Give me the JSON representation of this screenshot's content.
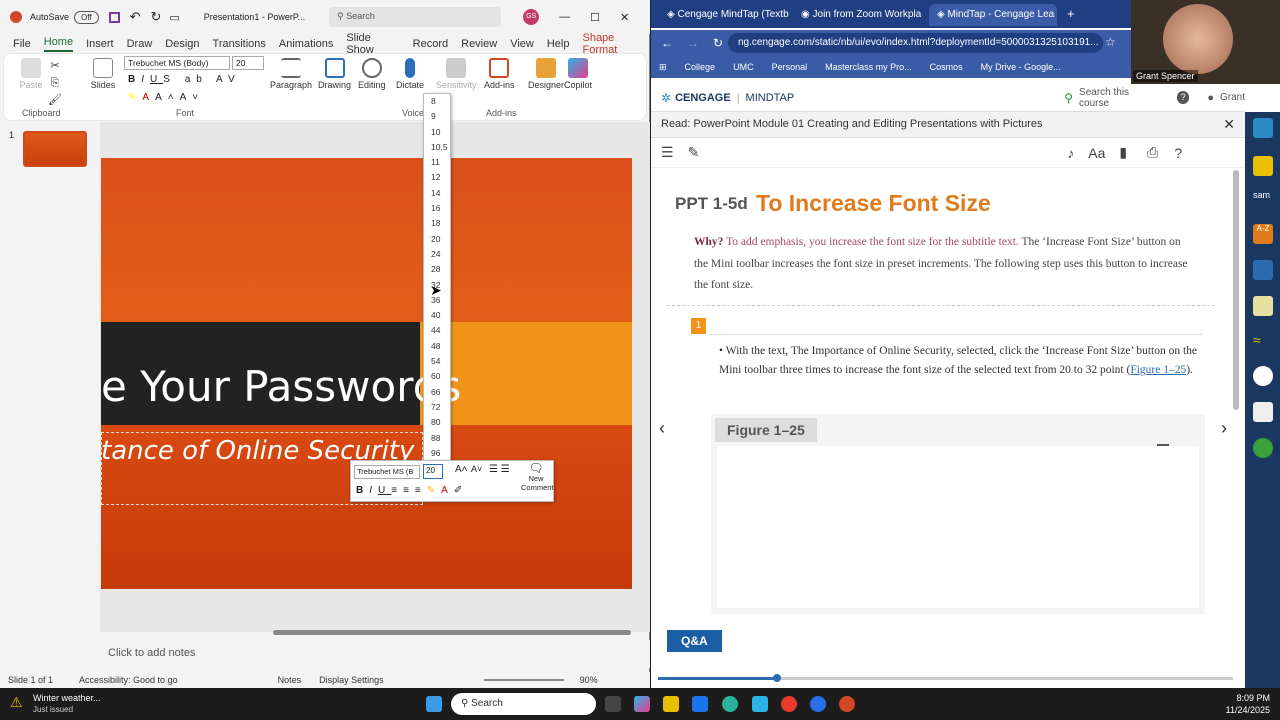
{
  "powerpoint": {
    "autosave_label": "AutoSave",
    "autosave_state": "Off",
    "doc_title": "Presentation1 - PowerP...",
    "search_placeholder": "Search",
    "user_initials": "GS",
    "tabs": [
      "File",
      "Home",
      "Insert",
      "Draw",
      "Design",
      "Transitions",
      "Animations",
      "Slide Show",
      "Record",
      "Review",
      "View",
      "Help",
      "Shape Format"
    ],
    "active_tab": "Home",
    "ribbon": {
      "paste": "Paste",
      "clipboard": "Clipboard",
      "slides": "Slides",
      "font_name": "Trebuchet MS (Body)",
      "font_size": "20",
      "font_group": "Font",
      "paragraph": "Paragraph",
      "drawing": "Drawing",
      "editing": "Editing",
      "dictate": "Dictate",
      "voice": "Voice",
      "sensitivity": "Sensitivity",
      "addins_btn": "Add-ins",
      "addins_grp": "Add-ins",
      "designer": "Designer",
      "copilot": "Copilot"
    },
    "slide_number": "1",
    "slide_title": "e Your Passwords",
    "slide_subtitle": "tance of Online Security",
    "notes_placeholder": "Click to add notes",
    "font_size_options": [
      "8",
      "9",
      "10",
      "10.5",
      "11",
      "12",
      "14",
      "16",
      "18",
      "20",
      "24",
      "28",
      "32",
      "36",
      "40",
      "44",
      "48",
      "54",
      "60",
      "66",
      "72",
      "80",
      "88",
      "96"
    ],
    "mini_toolbar": {
      "font": "Trebuchet MS (B",
      "size": "20",
      "new_comment": "New Comment"
    },
    "status": {
      "slide": "Slide 1 of 1",
      "accessibility": "Accessibility: Good to go",
      "notes": "Notes",
      "display": "Display Settings",
      "zoom": "90%"
    }
  },
  "chrome": {
    "tabs": [
      {
        "label": "Cengage MindTap (Textb"
      },
      {
        "label": "Join from Zoom Workpla"
      },
      {
        "label": "MindTap - Cengage Lea"
      }
    ],
    "url": "ng.cengage.com/static/nb/ui/evo/index.html?deploymentId=5000031325103191...",
    "bookmarks": [
      "College",
      "UMC",
      "Personal",
      "Masterclass my Pro...",
      "Cosmos",
      "My Drive - Google..."
    ],
    "webcam_name": "Grant Spencer"
  },
  "mindtap": {
    "brand": "CENGAGE",
    "product": "MINDTAP",
    "search": "Search this course",
    "user": "Grant",
    "read_title": "Read: PowerPoint Module 01 Creating and Editing Presentations with Pictures",
    "section_num": "PPT 1-5d",
    "section_title": "To Increase Font Size",
    "why_label": "Why?",
    "why_text": "To add emphasis, you increase the font size for the subtitle text.",
    "body_text": "The ‘Increase Font Size’ button on the Mini toolbar increases the font size in preset increments. The following step uses this button to increase the font size.",
    "step_num": "1",
    "step_text": "With the text, The Importance of Online Security, selected, click the ‘Increase Font Size’ button on the Mini toolbar three times to increase the font size of the selected text from 20 to 32 point (",
    "step_link": "Figure 1–25",
    "step_end": ").",
    "figure_label": "Figure 1–25",
    "qa": "Q&A"
  },
  "taskbar": {
    "weather_title": "Winter weather...",
    "weather_sub": "Just issued",
    "search": "Search",
    "time": "8:09 PM",
    "date": "11/24/2025"
  }
}
